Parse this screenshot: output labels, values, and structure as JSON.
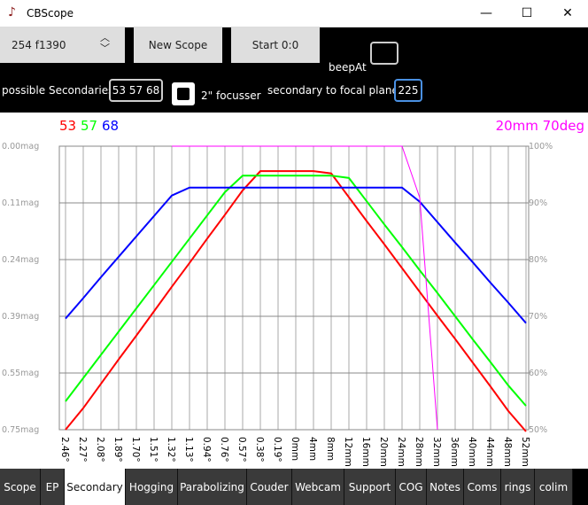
{
  "window": {
    "title": "CBScope",
    "minimize": "—",
    "maximize": "☐",
    "close": "✕"
  },
  "toolbar": {
    "scope_select": "254 f1390",
    "new_scope": "New Scope",
    "start": "Start 0:0",
    "beep_label": "beepAt",
    "beep_value": "",
    "secondaries_label": "possible Secondaries",
    "secondaries_value": "53 57 68",
    "focusser_label": "2\" focusser",
    "focusser_checked": false,
    "focal_label": "secondary to focal plane",
    "focal_value": "225"
  },
  "colors": {
    "red": "#ff0000",
    "green": "#00ff00",
    "blue": "#0000ff",
    "magenta": "#ff00ff",
    "grid": "#999999"
  },
  "chart_data": {
    "type": "line",
    "legend_left": [
      {
        "text": "53",
        "color": "#ff0000"
      },
      {
        "text": "57",
        "color": "#00ff00"
      },
      {
        "text": "68",
        "color": "#0000ff"
      }
    ],
    "legend_right": {
      "text": "20mm 70deg",
      "color": "#ff00ff"
    },
    "categories": [
      "2.46°",
      "2.27°",
      "2.08°",
      "1.89°",
      "1.70°",
      "1.51°",
      "1.32°",
      "1.13°",
      "0.94°",
      "0.76°",
      "0.57°",
      "0.38°",
      "0.19°",
      "0mm",
      "4mm",
      "8mm",
      "12mm",
      "16mm",
      "20mm",
      "24mm",
      "28mm",
      "32mm",
      "36mm",
      "40mm",
      "44mm",
      "48mm",
      "52mm"
    ],
    "y_left_ticks": [
      "0.00mag",
      "0.11mag",
      "0.24mag",
      "0.39mag",
      "0.55mag",
      "0.75mag"
    ],
    "y_right_ticks": [
      "100%",
      "90%",
      "80%",
      "70%",
      "60%",
      "50%"
    ],
    "ylim": [
      50,
      100
    ],
    "grid": true,
    "series": [
      {
        "name": "53",
        "color": "#ff0000",
        "values": [
          50,
          53.8,
          58.1,
          62.4,
          66.6,
          70.9,
          75.2,
          79.4,
          83.7,
          87.9,
          92.2,
          95.6,
          95.6,
          95.6,
          95.6,
          95.2,
          91.0,
          86.8,
          82.7,
          78.5,
          74.3,
          70.1,
          66.0,
          61.8,
          57.6,
          53.3,
          49.5
        ]
      },
      {
        "name": "57",
        "color": "#00ff00",
        "values": [
          55.0,
          59.1,
          63.2,
          67.3,
          71.4,
          75.5,
          79.6,
          83.7,
          87.8,
          91.9,
          94.8,
          94.8,
          94.8,
          94.8,
          94.8,
          94.8,
          94.4,
          90.3,
          86.2,
          82.2,
          78.1,
          74.1,
          70.0,
          65.9,
          61.9,
          57.8,
          54.2
        ]
      },
      {
        "name": "68",
        "color": "#0000ff",
        "values": [
          69.6,
          73.2,
          76.9,
          80.5,
          84.1,
          87.7,
          91.3,
          92.7,
          92.7,
          92.7,
          92.7,
          92.7,
          92.7,
          92.7,
          92.7,
          92.7,
          92.7,
          92.7,
          92.7,
          92.7,
          90.2,
          86.6,
          83.0,
          79.5,
          75.9,
          72.4,
          68.8
        ]
      },
      {
        "name": "20mm 70deg",
        "color": "#ff00ff",
        "values": [
          null,
          null,
          null,
          null,
          null,
          null,
          100,
          100,
          100,
          100,
          100,
          100,
          100,
          100,
          100,
          100,
          100,
          100,
          100,
          100,
          90.9,
          50,
          null,
          null,
          null,
          null,
          null
        ]
      }
    ]
  },
  "tabs": [
    {
      "label": "Scope",
      "selected": false
    },
    {
      "label": "EP",
      "selected": false
    },
    {
      "label": "Secondary",
      "selected": true
    },
    {
      "label": "Hogging",
      "selected": false
    },
    {
      "label": "Parabolizing",
      "selected": false
    },
    {
      "label": "Couder",
      "selected": false
    },
    {
      "label": "Webcam",
      "selected": false
    },
    {
      "label": "Support",
      "selected": false
    },
    {
      "label": "COG",
      "selected": false
    },
    {
      "label": "Notes",
      "selected": false
    },
    {
      "label": "Coms",
      "selected": false
    },
    {
      "label": "rings",
      "selected": false
    },
    {
      "label": "colim",
      "selected": false
    }
  ]
}
